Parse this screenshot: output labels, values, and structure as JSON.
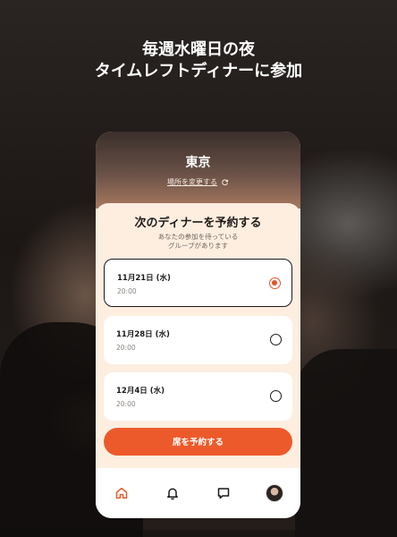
{
  "headline": {
    "line1": "毎週水曜日の夜",
    "line2": "タイムレフトディナーに参加"
  },
  "location": {
    "city": "東京",
    "change_label": "場所を変更する"
  },
  "sheet": {
    "title": "次のディナーを予約する",
    "subtitle_line1": "あなたの参加を待っている",
    "subtitle_line2": "グループがあります"
  },
  "dates": [
    {
      "date": "11月21日 (水)",
      "time": "20:00",
      "selected": true
    },
    {
      "date": "11月28日 (水)",
      "time": "20:00",
      "selected": false
    },
    {
      "date": "12月4日 (水)",
      "time": "20:00",
      "selected": false
    }
  ],
  "reserve_label": "席を予約する",
  "colors": {
    "accent": "#ec5a2b",
    "sheet_bg": "#fdeee0"
  },
  "tabbar": {
    "icons": [
      "home-icon",
      "bell-icon",
      "chat-icon",
      "profile-avatar"
    ],
    "active": "home-icon"
  }
}
